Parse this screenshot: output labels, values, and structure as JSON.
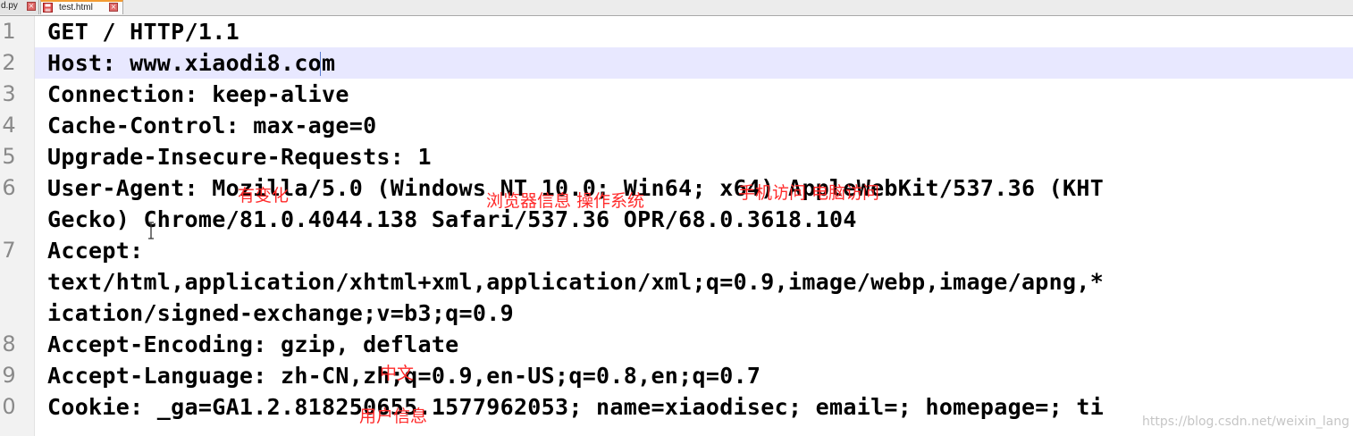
{
  "tabs": [
    {
      "label": "d.py",
      "active": false
    },
    {
      "label": "test.html",
      "active": true
    }
  ],
  "editor": {
    "current_line": 2,
    "lines": [
      {
        "number": "1",
        "text": "GET / HTTP/1.1"
      },
      {
        "number": "2",
        "text": "Host: www.xiaodi8.com"
      },
      {
        "number": "3",
        "text": "Connection: keep-alive"
      },
      {
        "number": "4",
        "text": "Cache-Control: max-age=0"
      },
      {
        "number": "5",
        "text": "Upgrade-Insecure-Requests: 1"
      },
      {
        "number": "6",
        "text": "User-Agent: Mozilla/5.0 (Windows NT 10.0; Win64; x64) AppleWebKit/537.36 (KHT"
      },
      {
        "number": "",
        "text": "Gecko) Chrome/81.0.4044.138 Safari/537.36 OPR/68.0.3618.104"
      },
      {
        "number": "7",
        "text": "Accept:"
      },
      {
        "number": "",
        "text": "text/html,application/xhtml+xml,application/xml;q=0.9,image/webp,image/apng,*"
      },
      {
        "number": "",
        "text": "ication/signed-exchange;v=b3;q=0.9"
      },
      {
        "number": "8",
        "text": "Accept-Encoding: gzip, deflate"
      },
      {
        "number": "9",
        "text": "Accept-Language: zh-CN,zh;q=0.9,en-US;q=0.8,en;q=0.7"
      },
      {
        "number": "0",
        "text": "Cookie: _ga=GA1.2.818250655.1577962053; name=xiaodisec; email=; homepage=; ti"
      }
    ]
  },
  "annotations": {
    "changes": "有变化",
    "browser_os": "浏览器信息 操作系统",
    "mobile_pc": "手机访问 电脑访问",
    "chinese": "中文",
    "user_info": "用户信息",
    "color": "#ff2a2a"
  },
  "watermark": "https://blog.csdn.net/weixin_lang"
}
